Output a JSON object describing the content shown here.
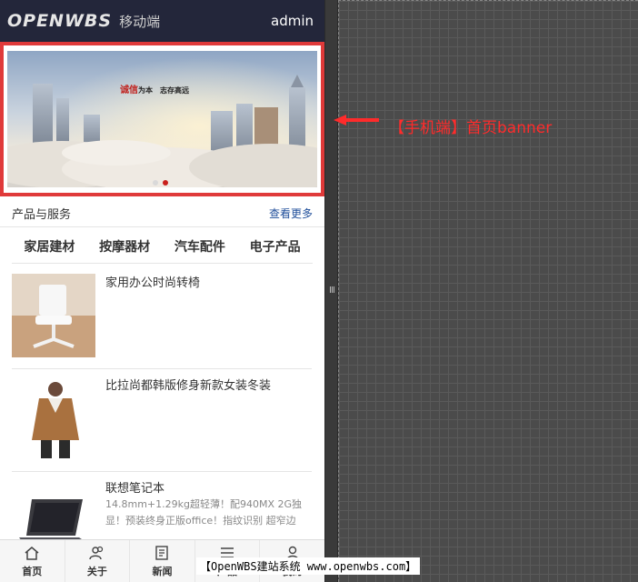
{
  "header": {
    "logo": "OPENWBS",
    "logo_sub": "移动端",
    "user": "admin"
  },
  "banner": {
    "slogan_red": "诚信",
    "slogan_rest": "为本　志存高远",
    "dots": 2,
    "active_dot": 2
  },
  "section": {
    "title": "产品与服务",
    "more": "查看更多"
  },
  "categories": [
    "家居建材",
    "按摩器材",
    "汽车配件",
    "电子产品"
  ],
  "products": [
    {
      "title": "家用办公时尚转椅",
      "desc": ""
    },
    {
      "title": "比拉尚都韩版修身新款女装冬装",
      "desc": ""
    },
    {
      "title": "联想笔记本",
      "desc": "14.8mm+1.29kg超轻薄！配940MX 2G独显！预装终身正版office！指纹识别 超窄边"
    }
  ],
  "tabs": [
    {
      "label": "首页",
      "icon": "home-icon"
    },
    {
      "label": "关于",
      "icon": "users-icon"
    },
    {
      "label": "新闻",
      "icon": "news-icon"
    },
    {
      "label": "产品",
      "icon": "list-icon"
    },
    {
      "label": "我的",
      "icon": "user-icon"
    }
  ],
  "annotation": {
    "text": "【手机端】首页banner",
    "color": "#ff2b2b"
  },
  "footer_note": "【OpenWBS建站系统 www.openwbs.com】",
  "splitter_grip": "Ⅲ"
}
